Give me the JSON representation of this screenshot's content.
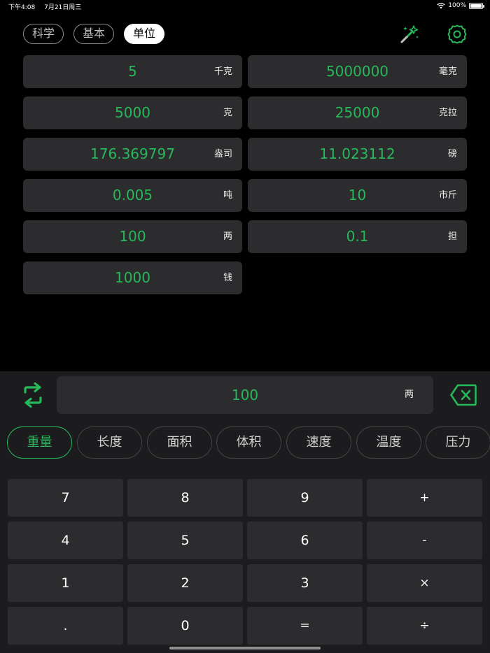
{
  "status_bar": {
    "time": "下午4:08",
    "date": "7月21日周三",
    "battery": "100%",
    "battery_level": 1.0
  },
  "mode_tabs": [
    {
      "label": "科学",
      "active": false
    },
    {
      "label": "基本",
      "active": false
    },
    {
      "label": "单位",
      "active": true
    }
  ],
  "icons": {
    "wand": "magic-wand-icon",
    "settings": "gear-icon",
    "swap": "swap-arrows-icon",
    "backspace": "backspace-icon"
  },
  "conversions": [
    {
      "value": "5",
      "unit": "千克"
    },
    {
      "value": "5000000",
      "unit": "毫克"
    },
    {
      "value": "5000",
      "unit": "克"
    },
    {
      "value": "25000",
      "unit": "克拉"
    },
    {
      "value": "176.369797",
      "unit": "盎司"
    },
    {
      "value": "11.023112",
      "unit": "磅"
    },
    {
      "value": "0.005",
      "unit": "吨"
    },
    {
      "value": "10",
      "unit": "市斤"
    },
    {
      "value": "100",
      "unit": "两"
    },
    {
      "value": "0.1",
      "unit": "担"
    },
    {
      "value": "1000",
      "unit": "钱"
    }
  ],
  "input": {
    "value": "100",
    "unit": "两"
  },
  "categories": [
    {
      "label": "重量",
      "active": true
    },
    {
      "label": "长度",
      "active": false
    },
    {
      "label": "面积",
      "active": false
    },
    {
      "label": "体积",
      "active": false
    },
    {
      "label": "速度",
      "active": false
    },
    {
      "label": "温度",
      "active": false
    },
    {
      "label": "压力",
      "active": false
    }
  ],
  "keypad": [
    "7",
    "8",
    "9",
    "+",
    "4",
    "5",
    "6",
    "-",
    "1",
    "2",
    "3",
    "×",
    ".",
    "0",
    "=",
    "÷"
  ],
  "colors": {
    "accent": "#27b85a",
    "background": "#000000",
    "panel": "#1c1c1e",
    "cell": "#2c2c2e"
  }
}
